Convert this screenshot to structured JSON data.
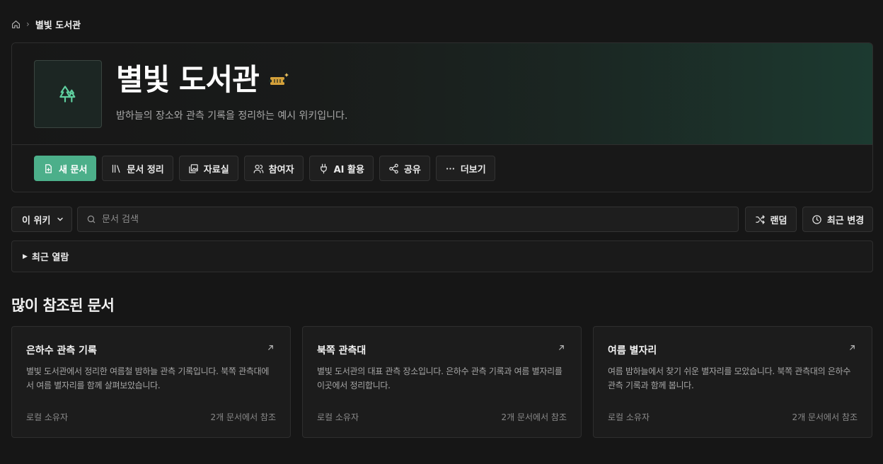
{
  "breadcrumb": {
    "home_icon": "home-icon",
    "current": "별빛 도서관"
  },
  "hero": {
    "logo_icon": "tree-icon",
    "title": "별빛 도서관",
    "badge_icon": "ticket-sparkle-icon",
    "description": "밤하늘의 장소와 관측 기록을 정리하는 예시 위키입니다."
  },
  "actions": [
    {
      "label": "새 문서",
      "icon": "new-document-icon"
    },
    {
      "label": "문서 정리",
      "icon": "library-icon"
    },
    {
      "label": "자료실",
      "icon": "gallery-icon"
    },
    {
      "label": "참여자",
      "icon": "users-icon"
    },
    {
      "label": "AI 활용",
      "icon": "plug-icon"
    },
    {
      "label": "공유",
      "icon": "share-icon"
    },
    {
      "label": "더보기",
      "icon": "more-icon"
    }
  ],
  "search": {
    "scope": "이 위키",
    "placeholder": "문서 검색",
    "random_label": "랜덤",
    "recent_changes_label": "최근 변경"
  },
  "recent_view": {
    "label": "최근 열람"
  },
  "popular": {
    "title": "많이 참조된 문서",
    "cards": [
      {
        "title": "은하수 관측 기록",
        "description": "별빛 도서관에서 정리한 여름철 밤하늘 관측 기록입니다. 북쪽 관측대에서 여름 별자리를 함께 살펴보았습니다.",
        "owner": "로컬 소유자",
        "refs": "2개 문서에서 참조"
      },
      {
        "title": "북쪽 관측대",
        "description": "별빛 도서관의 대표 관측 장소입니다. 은하수 관측 기록과 여름 별자리를 이곳에서 정리합니다.",
        "owner": "로컬 소유자",
        "refs": "2개 문서에서 참조"
      },
      {
        "title": "여름 별자리",
        "description": "여름 밤하늘에서 찾기 쉬운 별자리를 모았습니다. 북쪽 관측대의 은하수 관측 기록과 함께 봅니다.",
        "owner": "로컬 소유자",
        "refs": "2개 문서에서 참조"
      }
    ]
  },
  "colors": {
    "accent": "#4caf8a",
    "background": "#161616"
  }
}
